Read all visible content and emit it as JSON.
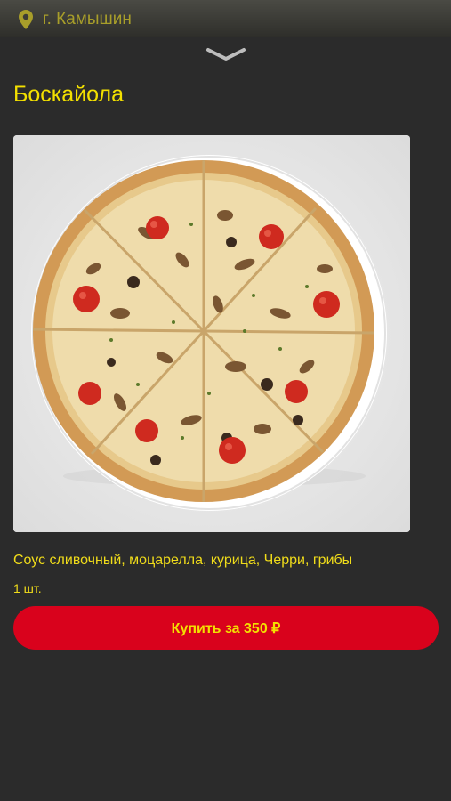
{
  "header": {
    "city": "г. Камышин",
    "location_icon": "location-pin-icon",
    "collapse_icon": "chevron-down-icon"
  },
  "product": {
    "title": "Боскайола",
    "image": "pizza-photo",
    "description": "Соус сливочный, моцарелла, курица, Черри, грибы",
    "quantity": "1 шт.",
    "buy_label": "Купить за 350 ₽"
  },
  "colors": {
    "background": "#2b2b2b",
    "accent_yellow": "#f3e000",
    "button_red": "#d9021c"
  }
}
